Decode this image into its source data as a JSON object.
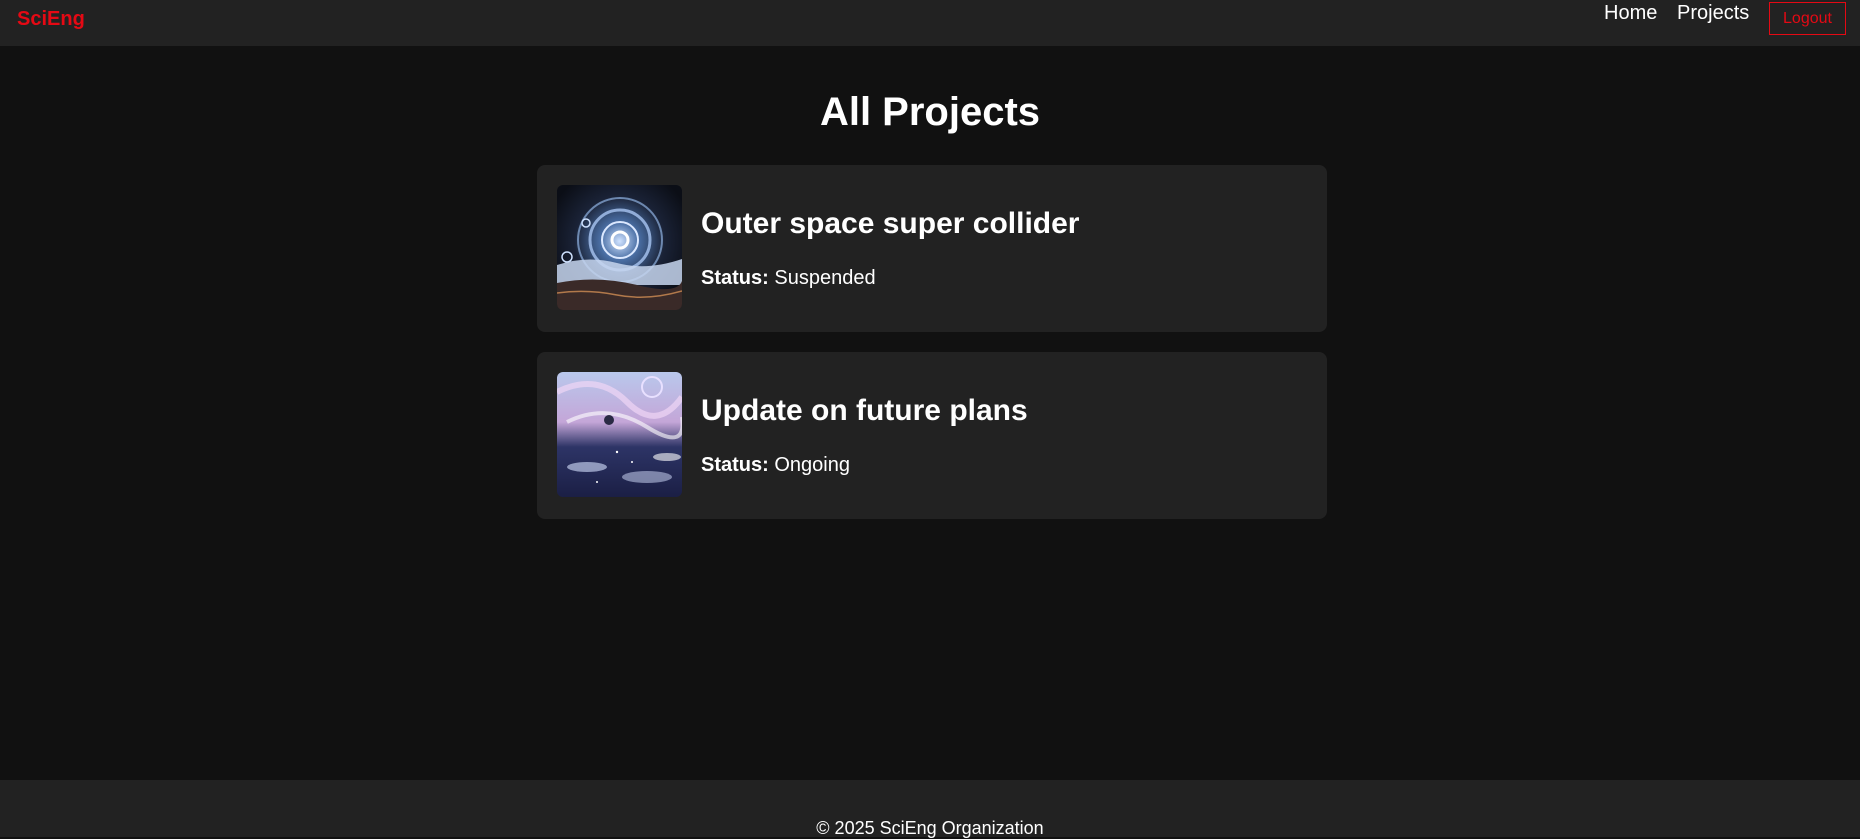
{
  "nav": {
    "brand": "SciEng",
    "links": [
      "Home",
      "Projects"
    ],
    "logout": "Logout",
    "accent_color": "#e50914"
  },
  "page": {
    "title": "All Projects"
  },
  "projects": [
    {
      "title": "Outer space super collider",
      "status_label": "Status:",
      "status": "Suspended",
      "image": "collider-thumbnail"
    },
    {
      "title": "Update on future plans",
      "status_label": "Status:",
      "status": "Ongoing",
      "image": "cosmic-landscape-thumbnail"
    }
  ],
  "footer": {
    "text": "© 2025 SciEng Organization"
  }
}
